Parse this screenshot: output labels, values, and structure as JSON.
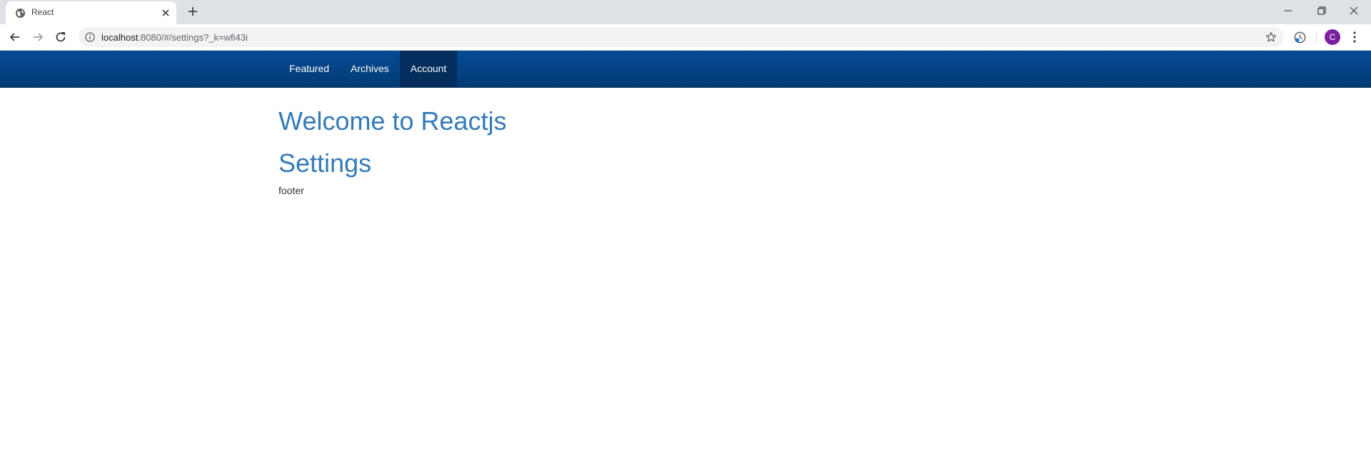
{
  "browser": {
    "tab_title": "React",
    "url_host": "localhost",
    "url_rest": ":8080/#/settings?_k=wfi43i",
    "profile_initial": "C"
  },
  "nav": {
    "items": [
      {
        "label": "Featured",
        "active": false
      },
      {
        "label": "Archives",
        "active": false
      },
      {
        "label": "Account",
        "active": true
      }
    ]
  },
  "main": {
    "title": "Welcome to Reactjs",
    "subtitle": "Settings",
    "footer": "footer"
  },
  "colors": {
    "nav_top": "#064b95",
    "nav_bottom": "#033a73",
    "nav_active": "#022d5d",
    "heading": "#337ab7",
    "profile": "#7b1fa2"
  },
  "icons": [
    "globe-icon",
    "close-icon",
    "plus-icon",
    "minimize-icon",
    "restore-icon",
    "back-icon",
    "forward-icon",
    "reload-icon",
    "info-icon",
    "star-icon",
    "extension-icon",
    "menu-dots-icon"
  ]
}
